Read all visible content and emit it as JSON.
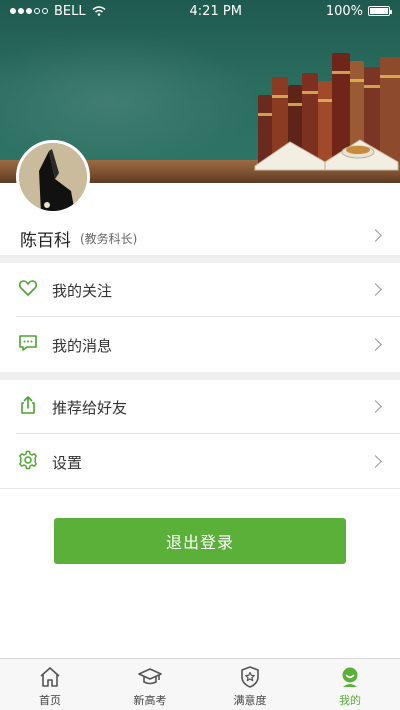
{
  "status_bar": {
    "carrier": "BELL",
    "time": "4:21 PM",
    "battery": "100%"
  },
  "profile": {
    "name": "陈百科",
    "role": "(教务科长)"
  },
  "menu": {
    "groups": [
      [
        {
          "label": "我的关注",
          "icon": "heart-icon"
        },
        {
          "label": "我的消息",
          "icon": "message-icon"
        }
      ],
      [
        {
          "label": "推荐给好友",
          "icon": "share-icon"
        },
        {
          "label": "设置",
          "icon": "gear-icon"
        }
      ]
    ]
  },
  "logout_label": "退出登录",
  "tabbar": {
    "active": 3,
    "items": [
      {
        "label": "首页",
        "icon": "home-icon"
      },
      {
        "label": "新高考",
        "icon": "graduation-cap-icon"
      },
      {
        "label": "满意度",
        "icon": "star-shield-icon"
      },
      {
        "label": "我的",
        "icon": "user-icon"
      }
    ]
  },
  "colors": {
    "accent": "#5bb03a",
    "icon_green": "#4aa52e",
    "chalkboard": "#2a6d5f"
  }
}
